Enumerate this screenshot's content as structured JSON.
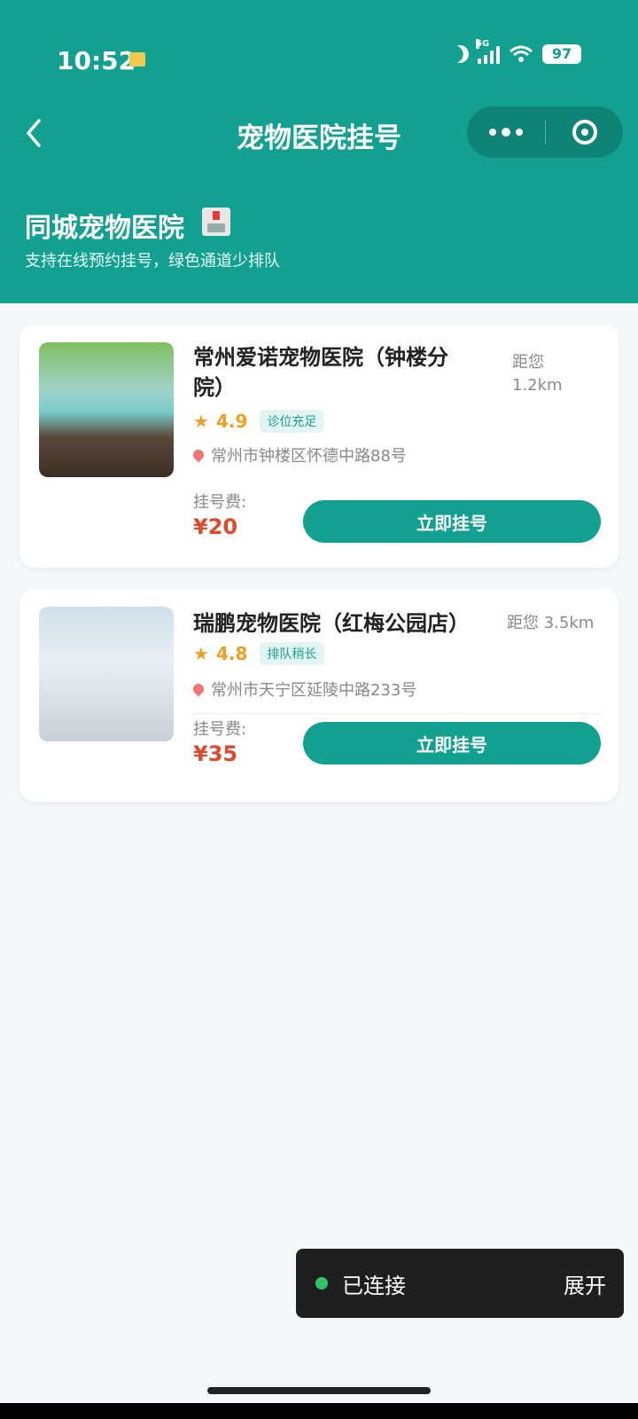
{
  "status_bar": {
    "time": "10:52",
    "network": "5G",
    "battery": "97"
  },
  "header": {
    "title": "宠物医院挂号",
    "back_icon": "back-chevron-icon",
    "more_icon": "more-dots-icon",
    "capsule_icon": "target-icon"
  },
  "intro": {
    "title": "同城宠物医院",
    "subtitle": "支持在线预约挂号，绿色通道少排队",
    "icon": "hospital-icon"
  },
  "hospitals": [
    {
      "name": "常州爱诺宠物医院（钟楼分院）",
      "distance": "距您 1.2km",
      "rating": "4.9",
      "tag": "诊位充足",
      "address": "常州市钟楼区怀德中路88号",
      "fee_label": "挂号费:",
      "fee": "¥20",
      "button": "立即挂号"
    },
    {
      "name": "瑞鹏宠物医院（红梅公园店）",
      "distance": "距您 3.5km",
      "rating": "4.8",
      "tag": "排队稍长",
      "address": "常州市天宁区延陵中路233号",
      "fee_label": "挂号费:",
      "fee": "¥35",
      "button": "立即挂号"
    }
  ],
  "toast": {
    "status": "已连接",
    "action": "展开"
  },
  "colors": {
    "primary": "#12a190",
    "price": "#e0492b",
    "rating": "#f0a020"
  }
}
